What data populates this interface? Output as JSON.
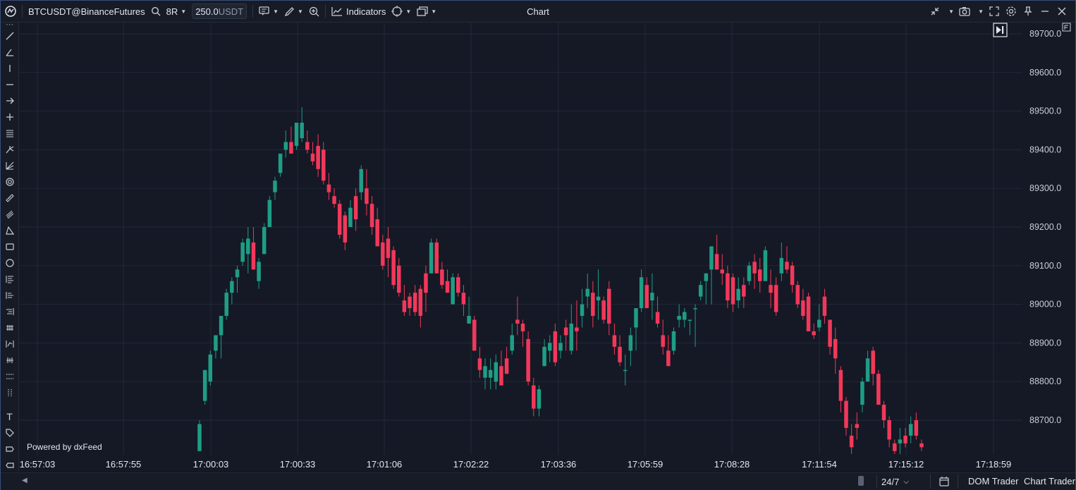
{
  "toolbar": {
    "symbol": "BTCUSDT@BinanceFutures",
    "bar_type": "8R",
    "quantity": "250.0",
    "quantity_unit": "USDT",
    "indicators_label": "Indicators",
    "title": "Chart"
  },
  "chart": {
    "watermark": "Powered by dxFeed",
    "colors": {
      "up": "#1f9d85",
      "down": "#f2385a",
      "background": "#141925",
      "grid": "#222938"
    },
    "price_labels": [
      "89700.0",
      "89600.0",
      "89500.0",
      "89400.0",
      "89300.0",
      "89200.0",
      "89100.0",
      "89000.0",
      "88900.0",
      "88800.0",
      "88700.0"
    ],
    "time_labels": [
      "16:57:03",
      "16:57:55",
      "17:00:03",
      "17:00:33",
      "17:01:06",
      "17:02:22",
      "17:03:36",
      "17:05:59",
      "17:08:28",
      "17:11:54",
      "17:15:12",
      "17:18:59"
    ]
  },
  "chart_data": {
    "type": "candlestick",
    "ylim": [
      88610,
      89730
    ],
    "x_ticks": [
      "16:57:03",
      "16:57:55",
      "17:00:03",
      "17:00:33",
      "17:01:06",
      "17:02:22",
      "17:03:36",
      "17:05:59",
      "17:08:28",
      "17:11:54",
      "17:15:12",
      "17:18:59"
    ],
    "candles": [
      {
        "o": 88620,
        "h": 88700,
        "l": 88620,
        "c": 88690
      },
      {
        "o": 88750,
        "h": 88760,
        "l": 88740,
        "c": 88830
      },
      {
        "o": 88800,
        "h": 88880,
        "l": 88790,
        "c": 88870
      },
      {
        "o": 88880,
        "h": 88900,
        "l": 88860,
        "c": 88920
      },
      {
        "o": 88920,
        "h": 88970,
        "l": 88860,
        "c": 88970
      },
      {
        "o": 88970,
        "h": 89040,
        "l": 88960,
        "c": 89030
      },
      {
        "o": 89030,
        "h": 89070,
        "l": 89000,
        "c": 89060
      },
      {
        "o": 89070,
        "h": 89100,
        "l": 89030,
        "c": 89090
      },
      {
        "o": 89110,
        "h": 89170,
        "l": 89100,
        "c": 89160
      },
      {
        "o": 89130,
        "h": 89200,
        "l": 89080,
        "c": 89170
      },
      {
        "o": 89160,
        "h": 89200,
        "l": 89090,
        "c": 89090
      },
      {
        "o": 89060,
        "h": 89120,
        "l": 89040,
        "c": 89110
      },
      {
        "o": 89130,
        "h": 89210,
        "l": 89130,
        "c": 89200
      },
      {
        "o": 89200,
        "h": 89280,
        "l": 89200,
        "c": 89270
      },
      {
        "o": 89290,
        "h": 89330,
        "l": 89270,
        "c": 89320
      },
      {
        "o": 89340,
        "h": 89380,
        "l": 89330,
        "c": 89390
      },
      {
        "o": 89400,
        "h": 89450,
        "l": 89380,
        "c": 89420
      },
      {
        "o": 89420,
        "h": 89460,
        "l": 89400,
        "c": 89390
      },
      {
        "o": 89410,
        "h": 89470,
        "l": 89400,
        "c": 89470
      },
      {
        "o": 89430,
        "h": 89510,
        "l": 89420,
        "c": 89470
      },
      {
        "o": 89420,
        "h": 89450,
        "l": 89390,
        "c": 89400
      },
      {
        "o": 89390,
        "h": 89420,
        "l": 89360,
        "c": 89370
      },
      {
        "o": 89410,
        "h": 89440,
        "l": 89330,
        "c": 89350
      },
      {
        "o": 89400,
        "h": 89420,
        "l": 89310,
        "c": 89320
      },
      {
        "o": 89310,
        "h": 89340,
        "l": 89270,
        "c": 89290
      },
      {
        "o": 89280,
        "h": 89300,
        "l": 89250,
        "c": 89260
      },
      {
        "o": 89260,
        "h": 89270,
        "l": 89170,
        "c": 89180
      },
      {
        "o": 89230,
        "h": 89240,
        "l": 89140,
        "c": 89160
      },
      {
        "o": 89200,
        "h": 89270,
        "l": 89200,
        "c": 89250
      },
      {
        "o": 89280,
        "h": 89300,
        "l": 89190,
        "c": 89220
      },
      {
        "o": 89290,
        "h": 89360,
        "l": 89270,
        "c": 89350
      },
      {
        "o": 89300,
        "h": 89350,
        "l": 89230,
        "c": 89260
      },
      {
        "o": 89260,
        "h": 89280,
        "l": 89180,
        "c": 89200
      },
      {
        "o": 89220,
        "h": 89250,
        "l": 89160,
        "c": 89150
      },
      {
        "o": 89160,
        "h": 89180,
        "l": 89090,
        "c": 89100
      },
      {
        "o": 89170,
        "h": 89200,
        "l": 89070,
        "c": 89120
      },
      {
        "o": 89140,
        "h": 89150,
        "l": 89040,
        "c": 89050
      },
      {
        "o": 89100,
        "h": 89120,
        "l": 89020,
        "c": 89030
      },
      {
        "o": 89010,
        "h": 89050,
        "l": 88970,
        "c": 88980
      },
      {
        "o": 89020,
        "h": 89030,
        "l": 88970,
        "c": 88990
      },
      {
        "o": 89030,
        "h": 89050,
        "l": 88970,
        "c": 88980
      },
      {
        "o": 89040,
        "h": 89050,
        "l": 88940,
        "c": 88970
      },
      {
        "o": 89080,
        "h": 89100,
        "l": 88980,
        "c": 89030
      },
      {
        "o": 89080,
        "h": 89170,
        "l": 89080,
        "c": 89160
      },
      {
        "o": 89160,
        "h": 89170,
        "l": 89080,
        "c": 89080
      },
      {
        "o": 89090,
        "h": 89110,
        "l": 89040,
        "c": 89050
      },
      {
        "o": 89060,
        "h": 89090,
        "l": 89030,
        "c": 89030
      },
      {
        "o": 89000,
        "h": 89080,
        "l": 89000,
        "c": 89070
      },
      {
        "o": 89070,
        "h": 89080,
        "l": 89020,
        "c": 89030
      },
      {
        "o": 89030,
        "h": 89050,
        "l": 88970,
        "c": 89000
      },
      {
        "o": 88950,
        "h": 89020,
        "l": 88950,
        "c": 88970
      },
      {
        "o": 88960,
        "h": 88970,
        "l": 88880,
        "c": 88880
      },
      {
        "o": 88860,
        "h": 88890,
        "l": 88810,
        "c": 88830
      },
      {
        "o": 88810,
        "h": 88860,
        "l": 88780,
        "c": 88840
      },
      {
        "o": 88810,
        "h": 88860,
        "l": 88780,
        "c": 88830
      },
      {
        "o": 88800,
        "h": 88870,
        "l": 88780,
        "c": 88850
      },
      {
        "o": 88840,
        "h": 88880,
        "l": 88800,
        "c": 88790
      },
      {
        "o": 88860,
        "h": 88890,
        "l": 88830,
        "c": 88820
      },
      {
        "o": 88880,
        "h": 88950,
        "l": 88870,
        "c": 88920
      },
      {
        "o": 88960,
        "h": 89020,
        "l": 88920,
        "c": 88950
      },
      {
        "o": 88950,
        "h": 88960,
        "l": 88890,
        "c": 88930
      },
      {
        "o": 88910,
        "h": 88930,
        "l": 88790,
        "c": 88800
      },
      {
        "o": 88790,
        "h": 88810,
        "l": 88710,
        "c": 88730
      },
      {
        "o": 88730,
        "h": 88790,
        "l": 88710,
        "c": 88780
      },
      {
        "o": 88840,
        "h": 88910,
        "l": 88840,
        "c": 88890
      },
      {
        "o": 88880,
        "h": 88920,
        "l": 88850,
        "c": 88900
      },
      {
        "o": 88930,
        "h": 88950,
        "l": 88840,
        "c": 88850
      },
      {
        "o": 88880,
        "h": 88920,
        "l": 88860,
        "c": 88900
      },
      {
        "o": 88940,
        "h": 88960,
        "l": 88880,
        "c": 88920
      },
      {
        "o": 88880,
        "h": 89000,
        "l": 88870,
        "c": 88950
      },
      {
        "o": 88940,
        "h": 89010,
        "l": 88880,
        "c": 88930
      },
      {
        "o": 88970,
        "h": 89040,
        "l": 88940,
        "c": 89000
      },
      {
        "o": 89020,
        "h": 89080,
        "l": 88990,
        "c": 89040
      },
      {
        "o": 89030,
        "h": 89060,
        "l": 88940,
        "c": 88970
      },
      {
        "o": 89010,
        "h": 89090,
        "l": 88960,
        "c": 89020
      },
      {
        "o": 89010,
        "h": 89020,
        "l": 88950,
        "c": 88960
      },
      {
        "o": 89040,
        "h": 89060,
        "l": 88920,
        "c": 88950
      },
      {
        "o": 88920,
        "h": 88950,
        "l": 88870,
        "c": 88890
      },
      {
        "o": 88890,
        "h": 88920,
        "l": 88840,
        "c": 88850
      },
      {
        "o": 88830,
        "h": 88870,
        "l": 88790,
        "c": 88830
      },
      {
        "o": 88880,
        "h": 88940,
        "l": 88840,
        "c": 88920
      },
      {
        "o": 88940,
        "h": 88990,
        "l": 88880,
        "c": 88990
      },
      {
        "o": 88990,
        "h": 89090,
        "l": 88980,
        "c": 89070
      },
      {
        "o": 89050,
        "h": 89070,
        "l": 88990,
        "c": 88990
      },
      {
        "o": 89010,
        "h": 89080,
        "l": 88960,
        "c": 89030
      },
      {
        "o": 88980,
        "h": 89020,
        "l": 88940,
        "c": 88950
      },
      {
        "o": 88920,
        "h": 88960,
        "l": 88870,
        "c": 88890
      },
      {
        "o": 88880,
        "h": 88920,
        "l": 88860,
        "c": 88840
      },
      {
        "o": 88880,
        "h": 88940,
        "l": 88870,
        "c": 88930
      },
      {
        "o": 88960,
        "h": 89000,
        "l": 88940,
        "c": 88970
      },
      {
        "o": 88960,
        "h": 88990,
        "l": 88940,
        "c": 88980
      },
      {
        "o": 88960,
        "h": 88960,
        "l": 88920,
        "c": 88960
      },
      {
        "o": 88990,
        "h": 89000,
        "l": 88890,
        "c": 88990
      },
      {
        "o": 89020,
        "h": 89060,
        "l": 89010,
        "c": 89050
      },
      {
        "o": 89060,
        "h": 89080,
        "l": 89000,
        "c": 89080
      },
      {
        "o": 89090,
        "h": 89150,
        "l": 89000,
        "c": 89150
      },
      {
        "o": 89130,
        "h": 89180,
        "l": 89090,
        "c": 89090
      },
      {
        "o": 89090,
        "h": 89130,
        "l": 89050,
        "c": 89080
      },
      {
        "o": 89080,
        "h": 89100,
        "l": 88990,
        "c": 89010
      },
      {
        "o": 89070,
        "h": 89080,
        "l": 88980,
        "c": 89000
      },
      {
        "o": 89010,
        "h": 89070,
        "l": 88990,
        "c": 89040
      },
      {
        "o": 89050,
        "h": 89070,
        "l": 88990,
        "c": 89020
      },
      {
        "o": 89060,
        "h": 89110,
        "l": 89050,
        "c": 89100
      },
      {
        "o": 89110,
        "h": 89130,
        "l": 89040,
        "c": 89080
      },
      {
        "o": 89090,
        "h": 89120,
        "l": 89030,
        "c": 89060
      },
      {
        "o": 89060,
        "h": 89150,
        "l": 89060,
        "c": 89140
      },
      {
        "o": 89050,
        "h": 89090,
        "l": 88990,
        "c": 89030
      },
      {
        "o": 89050,
        "h": 89070,
        "l": 88970,
        "c": 88980
      },
      {
        "o": 89080,
        "h": 89160,
        "l": 89060,
        "c": 89120
      },
      {
        "o": 89110,
        "h": 89150,
        "l": 89080,
        "c": 89090
      },
      {
        "o": 89100,
        "h": 89110,
        "l": 89030,
        "c": 89050
      },
      {
        "o": 89050,
        "h": 89060,
        "l": 88990,
        "c": 89000
      },
      {
        "o": 89010,
        "h": 89040,
        "l": 88960,
        "c": 88970
      },
      {
        "o": 89020,
        "h": 89030,
        "l": 88930,
        "c": 88930
      },
      {
        "o": 88930,
        "h": 88950,
        "l": 88910,
        "c": 88920
      },
      {
        "o": 88940,
        "h": 89000,
        "l": 88930,
        "c": 88960
      },
      {
        "o": 89020,
        "h": 89040,
        "l": 88950,
        "c": 88970
      },
      {
        "o": 88960,
        "h": 88960,
        "l": 88870,
        "c": 88890
      },
      {
        "o": 88910,
        "h": 88940,
        "l": 88820,
        "c": 88860
      },
      {
        "o": 88830,
        "h": 88840,
        "l": 88720,
        "c": 88750
      },
      {
        "o": 88750,
        "h": 88760,
        "l": 88660,
        "c": 88680
      },
      {
        "o": 88660,
        "h": 88690,
        "l": 88610,
        "c": 88630
      },
      {
        "o": 88690,
        "h": 88720,
        "l": 88650,
        "c": 88680
      },
      {
        "o": 88740,
        "h": 88810,
        "l": 88720,
        "c": 88800
      },
      {
        "o": 88800,
        "h": 88880,
        "l": 88800,
        "c": 88860
      },
      {
        "o": 88880,
        "h": 88890,
        "l": 88790,
        "c": 88820
      },
      {
        "o": 88820,
        "h": 88830,
        "l": 88740,
        "c": 88740
      },
      {
        "o": 88740,
        "h": 88750,
        "l": 88680,
        "c": 88700
      },
      {
        "o": 88700,
        "h": 88710,
        "l": 88630,
        "c": 88650
      },
      {
        "o": 88640,
        "h": 88650,
        "l": 88610,
        "c": 88620
      },
      {
        "o": 88640,
        "h": 88680,
        "l": 88610,
        "c": 88650
      },
      {
        "o": 88660,
        "h": 88680,
        "l": 88630,
        "c": 88640
      },
      {
        "o": 88660,
        "h": 88710,
        "l": 88640,
        "c": 88690
      },
      {
        "o": 88700,
        "h": 88720,
        "l": 88650,
        "c": 88660
      },
      {
        "o": 88640,
        "h": 88650,
        "l": 88620,
        "c": 88630
      }
    ]
  },
  "bottombar": {
    "session": "24/7",
    "dom_trader": "DOM Trader",
    "chart_trader": "Chart Trader"
  }
}
